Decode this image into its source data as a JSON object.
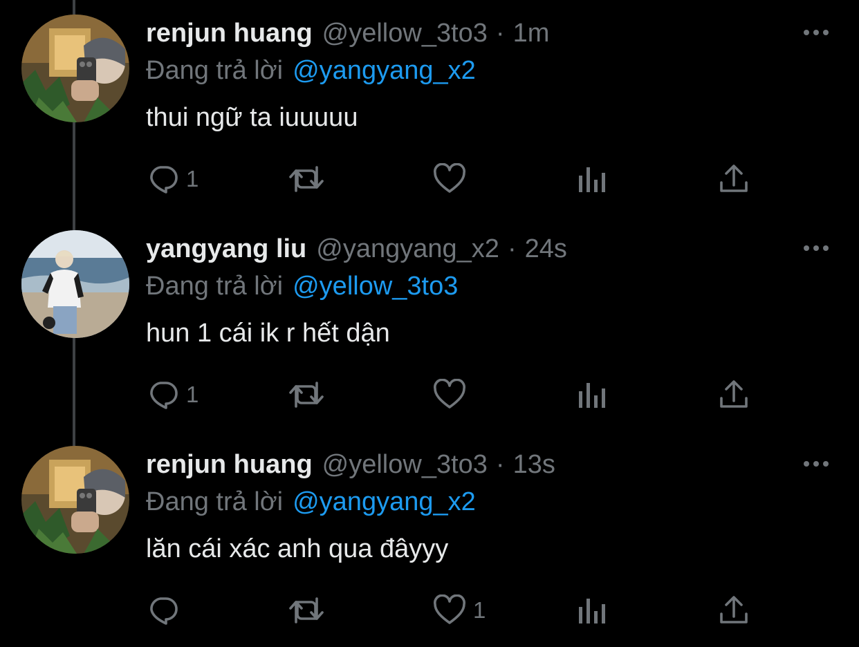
{
  "tweets": [
    {
      "name": "renjun huang",
      "handle": "@yellow_3to3",
      "dot": "·",
      "time": "1m",
      "reply_prefix": "Đang trả lời",
      "reply_to": "@yangyang_x2",
      "text": "thui ngữ ta iuuuuu",
      "reply_count": "1",
      "retweet_count": "",
      "like_count": "",
      "avatar_icon": "avatar-photo-mirror-selfie"
    },
    {
      "name": "yangyang liu",
      "handle": "@yangyang_x2",
      "dot": "·",
      "time": "24s",
      "reply_prefix": "Đang trả lời",
      "reply_to": "@yellow_3to3",
      "text": "hun 1 cái ik r hết dận",
      "reply_count": "1",
      "retweet_count": "",
      "like_count": "",
      "avatar_icon": "avatar-photo-beach"
    },
    {
      "name": "renjun huang",
      "handle": "@yellow_3to3",
      "dot": "·",
      "time": "13s",
      "reply_prefix": "Đang trả lời",
      "reply_to": "@yangyang_x2",
      "text": "lăn cái xác anh qua đâyyy",
      "reply_count": "",
      "retweet_count": "",
      "like_count": "1",
      "avatar_icon": "avatar-photo-mirror-selfie"
    }
  ],
  "icons": {
    "reply": "reply-icon",
    "retweet": "retweet-icon",
    "like": "heart-icon",
    "views": "views-icon",
    "share": "share-icon",
    "more": "more-icon"
  },
  "colors": {
    "background": "#000000",
    "text_primary": "#e7e9ea",
    "text_secondary": "#71767b",
    "accent_link": "#1d9bf0",
    "thread_line": "#3e4144"
  }
}
